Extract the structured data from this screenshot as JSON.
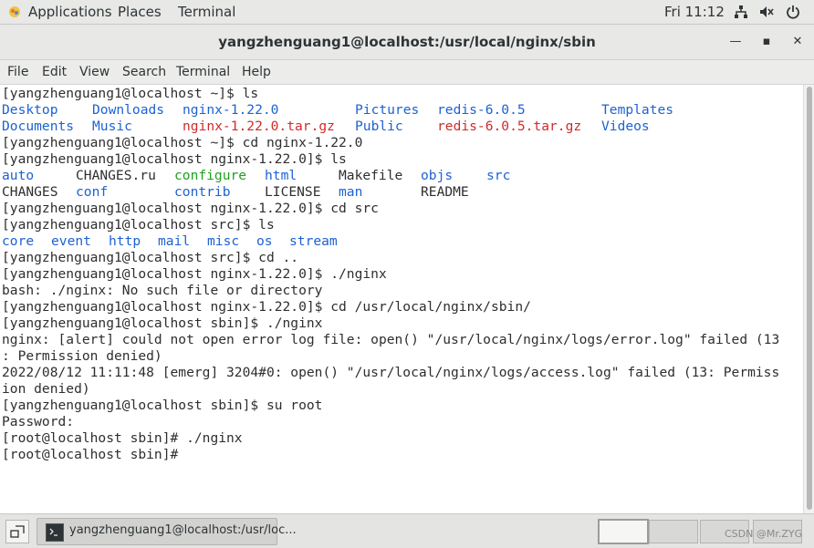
{
  "topbar": {
    "applications": "Applications",
    "places": "Places",
    "terminal": "Terminal",
    "clock": "Fri 11:12"
  },
  "window": {
    "title": "yangzhenguang1@localhost:/usr/local/nginx/sbin",
    "minimize_glyph": "—",
    "maximize_glyph": "▪",
    "close_glyph": "✕"
  },
  "menubar": [
    "File",
    "Edit",
    "View",
    "Search",
    "Terminal",
    "Help"
  ],
  "terminal_lines": [
    [
      {
        "t": "[yangzhenguang1@localhost ~]$ ls",
        "c": "plain"
      }
    ],
    [
      {
        "t": "Desktop",
        "c": "blue",
        "col": 0
      },
      {
        "t": "Downloads",
        "c": "blue",
        "col": 11
      },
      {
        "t": "nginx-1.22.0",
        "c": "blue",
        "col": 22
      },
      {
        "t": "Pictures",
        "c": "blue",
        "col": 43
      },
      {
        "t": "redis-6.0.5",
        "c": "blue",
        "col": 53
      },
      {
        "t": "Templates",
        "c": "blue",
        "col": 73
      }
    ],
    [
      {
        "t": "Documents",
        "c": "blue",
        "col": 0
      },
      {
        "t": "Music",
        "c": "blue",
        "col": 11
      },
      {
        "t": "nginx-1.22.0.tar.gz",
        "c": "red",
        "col": 22
      },
      {
        "t": "Public",
        "c": "blue",
        "col": 43
      },
      {
        "t": "redis-6.0.5.tar.gz",
        "c": "red",
        "col": 53
      },
      {
        "t": "Videos",
        "c": "blue",
        "col": 73
      }
    ],
    [
      {
        "t": "[yangzhenguang1@localhost ~]$ cd nginx-1.22.0",
        "c": "plain"
      }
    ],
    [
      {
        "t": "[yangzhenguang1@localhost nginx-1.22.0]$ ls",
        "c": "plain"
      }
    ],
    [
      {
        "t": "auto",
        "c": "blue",
        "col": 0
      },
      {
        "t": "CHANGES.ru",
        "c": "plain",
        "col": 9
      },
      {
        "t": "configure",
        "c": "green",
        "col": 21
      },
      {
        "t": "html",
        "c": "blue",
        "col": 32
      },
      {
        "t": "Makefile",
        "c": "plain",
        "col": 41
      },
      {
        "t": "objs",
        "c": "blue",
        "col": 51
      },
      {
        "t": "src",
        "c": "blue",
        "col": 59
      }
    ],
    [
      {
        "t": "CHANGES",
        "c": "plain",
        "col": 0
      },
      {
        "t": "conf",
        "c": "blue",
        "col": 9
      },
      {
        "t": "contrib",
        "c": "blue",
        "col": 21
      },
      {
        "t": "LICENSE",
        "c": "plain",
        "col": 32
      },
      {
        "t": "man",
        "c": "blue",
        "col": 41
      },
      {
        "t": "README",
        "c": "plain",
        "col": 51
      }
    ],
    [
      {
        "t": "[yangzhenguang1@localhost nginx-1.22.0]$ cd src",
        "c": "plain"
      }
    ],
    [
      {
        "t": "[yangzhenguang1@localhost src]$ ls",
        "c": "plain"
      }
    ],
    [
      {
        "t": "core",
        "c": "blue",
        "col": 0
      },
      {
        "t": "event",
        "c": "blue",
        "col": 6
      },
      {
        "t": "http",
        "c": "blue",
        "col": 13
      },
      {
        "t": "mail",
        "c": "blue",
        "col": 19
      },
      {
        "t": "misc",
        "c": "blue",
        "col": 25
      },
      {
        "t": "os",
        "c": "blue",
        "col": 31
      },
      {
        "t": "stream",
        "c": "blue",
        "col": 35
      }
    ],
    [
      {
        "t": "[yangzhenguang1@localhost src]$ cd ..",
        "c": "plain"
      }
    ],
    [
      {
        "t": "[yangzhenguang1@localhost nginx-1.22.0]$ ./nginx",
        "c": "plain"
      }
    ],
    [
      {
        "t": "bash: ./nginx: No such file or directory",
        "c": "plain"
      }
    ],
    [
      {
        "t": "[yangzhenguang1@localhost nginx-1.22.0]$ cd /usr/local/nginx/sbin/",
        "c": "plain"
      }
    ],
    [
      {
        "t": "[yangzhenguang1@localhost sbin]$ ./nginx",
        "c": "plain"
      }
    ],
    [
      {
        "t": "nginx: [alert] could not open error log file: open() \"/usr/local/nginx/logs/error.log\" failed (13",
        "c": "plain"
      }
    ],
    [
      {
        "t": ": Permission denied)",
        "c": "plain"
      }
    ],
    [
      {
        "t": "2022/08/12 11:11:48 [emerg] 3204#0: open() \"/usr/local/nginx/logs/access.log\" failed (13: Permiss",
        "c": "plain"
      }
    ],
    [
      {
        "t": "ion denied)",
        "c": "plain"
      }
    ],
    [
      {
        "t": "[yangzhenguang1@localhost sbin]$ su root",
        "c": "plain"
      }
    ],
    [
      {
        "t": "Password:",
        "c": "plain"
      }
    ],
    [
      {
        "t": "[root@localhost sbin]# ./nginx",
        "c": "plain"
      }
    ],
    [
      {
        "t": "[root@localhost sbin]# ",
        "c": "plain"
      }
    ]
  ],
  "taskbar": {
    "task_label": "yangzhenguang1@localhost:/usr/loc...",
    "watermark": "CSDN @Mr.ZYG"
  }
}
